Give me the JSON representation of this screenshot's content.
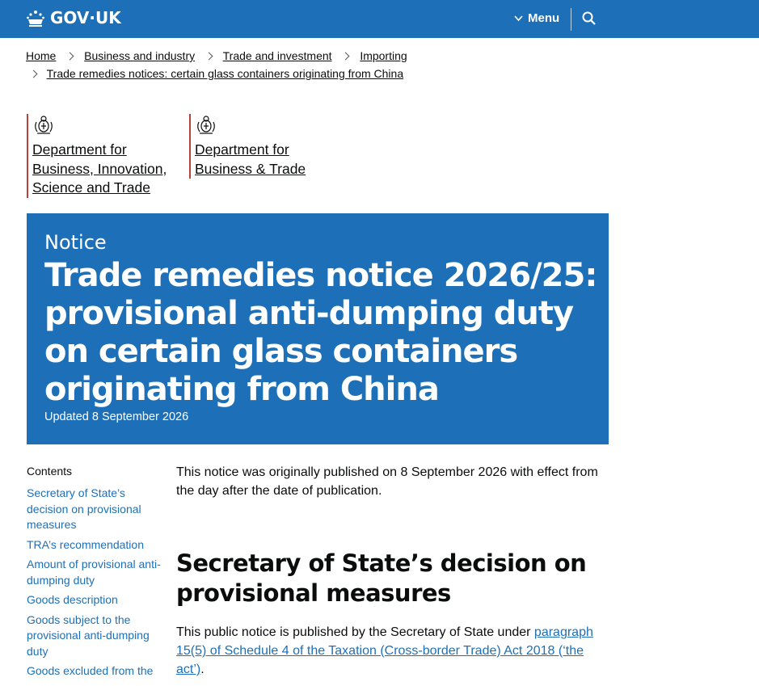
{
  "header": {
    "logo_text": "GOV·UK",
    "menu_label": "Menu",
    "search_icon": "search-icon",
    "color": "#1d70b8"
  },
  "breadcrumb": {
    "items": [
      "Home",
      "Business and industry",
      "Trade and investment",
      "Importing",
      "Trade remedies notices: certain glass containers originating from China"
    ]
  },
  "organisations": [
    {
      "line1": "Department for",
      "line2": "Business, Innovation,",
      "line3": "Science and Trade",
      "icon": "royal-crest-icon"
    },
    {
      "line1": "Department for",
      "line2": "Business & Trade",
      "icon": "royal-crest-icon"
    }
  ],
  "hero": {
    "kicker": "Notice",
    "title": "Trade remedies notice 2026/25: provisional anti-dumping duty on certain glass containers originating from China",
    "updated": "Updated 8 September 2026"
  },
  "contents": {
    "title": "Contents",
    "items": [
      "Secretary of State’s decision on provisional measures",
      "TRA’s recommendation",
      "Amount of provisional anti-dumping duty",
      "Goods description",
      "Goods subject to the provisional anti-dumping duty",
      "Goods excluded from the"
    ]
  },
  "main": {
    "intro": "This notice was originally published on 8 September 2026 with effect from the day after the date of publication.",
    "heading": "Secretary of State’s decision on provisional measures",
    "para_prefix": "This public notice is published by the Secretary of State under ",
    "para_link": "paragraph 15(5) of Schedule 4 of the Taxation (Cross-border Trade) Act 2018 (‘the act’)",
    "para_suffix": "."
  }
}
